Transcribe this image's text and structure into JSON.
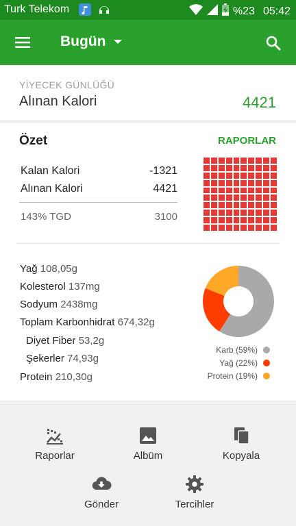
{
  "status_bar": {
    "carrier": "Turk Telekom",
    "battery": "%23",
    "time": "05:42"
  },
  "app_bar": {
    "title": "Bugün"
  },
  "food_log": {
    "section_label": "YİYECEK GÜNLÜĞÜ",
    "calories_label": "Alınan Kalori",
    "calories_value": "4421"
  },
  "summary": {
    "heading": "Özet",
    "reports_link": "RAPORLAR",
    "remaining_label": "Kalan Kalori",
    "remaining_value": "-1321",
    "consumed_label": "Alınan Kalori",
    "consumed_value": "4421",
    "tgd_label": "143% TGD",
    "tgd_value": "3100",
    "grid_filled_percent": 100,
    "nutrients": [
      {
        "name": "Yağ",
        "value": "108,05g"
      },
      {
        "name": "Kolesterol",
        "value": "137mg"
      },
      {
        "name": "Sodyum",
        "value": "2438mg"
      },
      {
        "name": "Toplam Karbonhidrat",
        "value": "674,32g"
      },
      {
        "name": "Diyet Fiber",
        "value": "53,2g"
      },
      {
        "name": "Şekerler",
        "value": "74,93g"
      },
      {
        "name": "Protein",
        "value": "210,30g"
      }
    ],
    "macros": [
      {
        "label": "Karb (59%)",
        "percent": 59,
        "color": "#a9a9a9"
      },
      {
        "label": "Yağ (22%)",
        "percent": 22,
        "color": "#ff3d00"
      },
      {
        "label": "Protein (19%)",
        "percent": 19,
        "color": "#ffa726"
      }
    ]
  },
  "actions": {
    "reports": "Raporlar",
    "album": "Albüm",
    "copy": "Kopyala",
    "send": "Gönder",
    "preferences": "Tercihler"
  },
  "colors": {
    "primary": "#2aa12d",
    "status_bar": "#1d8a1f",
    "accent_red": "#e53935"
  }
}
